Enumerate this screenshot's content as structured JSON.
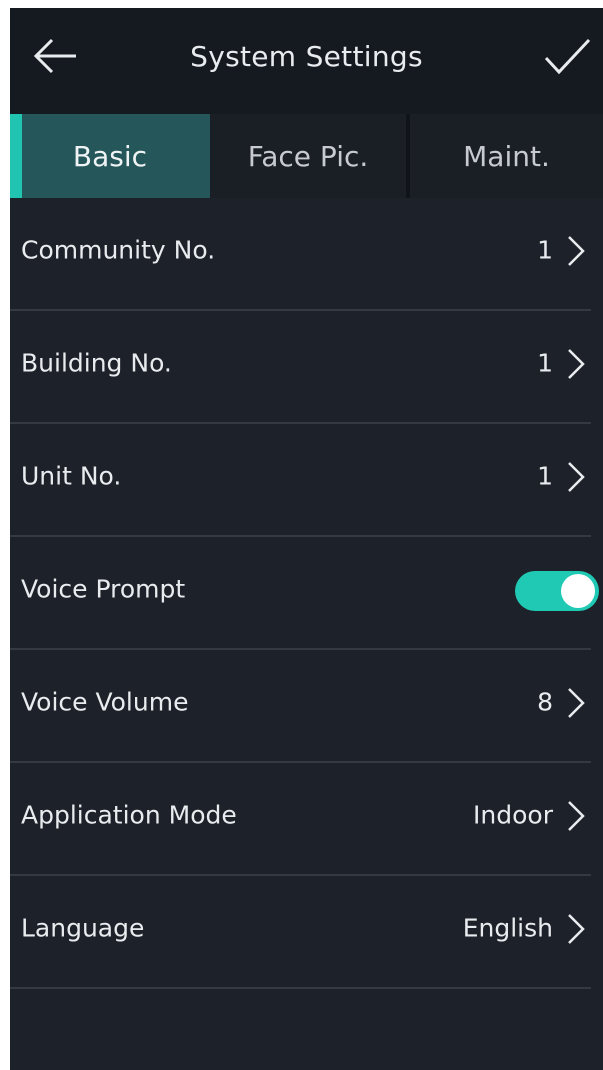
{
  "header": {
    "title": "System Settings",
    "back_icon": "arrow-left-icon",
    "confirm_icon": "checkmark-icon"
  },
  "tabs": [
    {
      "label": "Basic",
      "active": true
    },
    {
      "label": "Face Pic.",
      "active": false
    },
    {
      "label": "Maint.",
      "active": false
    }
  ],
  "settings": {
    "community_no": {
      "label": "Community No.",
      "value": "1"
    },
    "building_no": {
      "label": "Building No.",
      "value": "1"
    },
    "unit_no": {
      "label": "Unit No.",
      "value": "1"
    },
    "voice_prompt": {
      "label": "Voice Prompt",
      "enabled": true
    },
    "voice_volume": {
      "label": "Voice Volume",
      "value": "8"
    },
    "application_mode": {
      "label": "Application Mode",
      "value": "Indoor"
    },
    "language": {
      "label": "Language",
      "value": "English"
    }
  },
  "colors": {
    "accent": "#1fc9b3",
    "background": "#1d2129",
    "header": "#151a20",
    "active_tab": "#25575a"
  }
}
